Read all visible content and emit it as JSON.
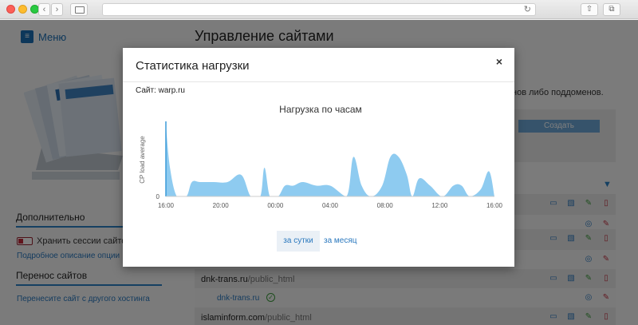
{
  "browser": {
    "back": "‹",
    "forward": "›",
    "reload": "↻",
    "share": "⇧",
    "tabs": "⧉"
  },
  "page": {
    "menu_label": "Меню",
    "title": "Управление сайтами",
    "right_text": "нов либо поддоменов.",
    "create_label": "Создать",
    "sidebar": {
      "additional_title": "Дополнительно",
      "session_label": "Хранить сессии сайтов",
      "options_link": "Подробное описание опции",
      "transfer_title": "Перенос сайтов",
      "transfer_link": "Перенесите сайт с другого хостинга"
    },
    "sites": [
      {
        "name": "dnk-trans.ru",
        "path": "/public_html",
        "sub": "dnk-trans.ru"
      },
      {
        "name": "islaminform.com",
        "path": "/public_html"
      }
    ]
  },
  "modal": {
    "title": "Статистика нагрузки",
    "close": "×",
    "site_prefix": "Сайт: warp.ru",
    "tab_day": "за сутки",
    "tab_month": "за месяц"
  },
  "chart_data": {
    "type": "area",
    "title": "Нагрузка по часам",
    "xlabel": "",
    "ylabel": "CP load average",
    "x_ticks": [
      "16:00",
      "20:00",
      "00:00",
      "04:00",
      "08:00",
      "12:00",
      "16:00"
    ],
    "y_ticks": [
      "0"
    ],
    "color": "#8ecbf0",
    "x": [
      0,
      0.3,
      0.8,
      1.5,
      1.9,
      2.5,
      3.5,
      4.5,
      5.5,
      6.2,
      6.9,
      7.2,
      7.6,
      8.2,
      8.7,
      9.3,
      10.0,
      11.0,
      12.0,
      13.2,
      13.7,
      14.3,
      15.0,
      15.8,
      16.4,
      17.0,
      17.6,
      18.0,
      18.5,
      19.3,
      20.2,
      21.0,
      21.6,
      22.2,
      23.0,
      23.6,
      24.0
    ],
    "y": [
      1.0,
      0.4,
      0.0,
      0.0,
      0.2,
      0.2,
      0.2,
      0.2,
      0.3,
      0.0,
      0.0,
      0.4,
      0.0,
      0.0,
      0.15,
      0.15,
      0.2,
      0.15,
      0.15,
      0.0,
      0.55,
      0.15,
      0.0,
      0.15,
      0.55,
      0.55,
      0.3,
      0.0,
      0.25,
      0.15,
      0.0,
      0.15,
      0.15,
      0.0,
      0.1,
      0.35,
      0.0
    ]
  }
}
